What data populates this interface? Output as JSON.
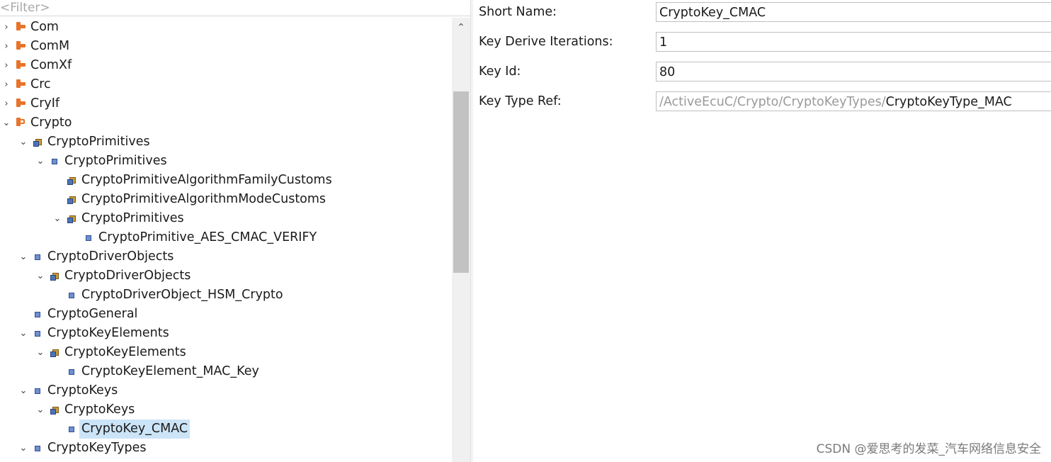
{
  "filter": {
    "placeholder": "<Filter>"
  },
  "tree": [
    {
      "label": "Com",
      "toggle": "›",
      "icon": "module-icon",
      "level": 0
    },
    {
      "label": "ComM",
      "toggle": "›",
      "icon": "module-icon",
      "level": 0
    },
    {
      "label": "ComXf",
      "toggle": "›",
      "icon": "module-icon",
      "level": 0
    },
    {
      "label": "Crc",
      "toggle": "›",
      "icon": "module-icon",
      "level": 0
    },
    {
      "label": "CryIf",
      "toggle": "›",
      "icon": "module-icon",
      "level": 0
    },
    {
      "label": "Crypto",
      "toggle": "⌄",
      "icon": "module-open-icon",
      "level": 0
    },
    {
      "label": "CryptoPrimitives",
      "toggle": "⌄",
      "icon": "container-icon",
      "level": 1
    },
    {
      "label": "CryptoPrimitives",
      "toggle": "⌄",
      "icon": "param-icon",
      "level": 2
    },
    {
      "label": "CryptoPrimitiveAlgorithmFamilyCustoms",
      "toggle": "",
      "icon": "container-icon",
      "level": 3
    },
    {
      "label": "CryptoPrimitiveAlgorithmModeCustoms",
      "toggle": "",
      "icon": "container-icon",
      "level": 3
    },
    {
      "label": "CryptoPrimitives",
      "toggle": "⌄",
      "icon": "container-icon",
      "level": 3
    },
    {
      "label": "CryptoPrimitive_AES_CMAC_VERIFY",
      "toggle": "",
      "icon": "param-icon",
      "level": 4
    },
    {
      "label": "CryptoDriverObjects",
      "toggle": "⌄",
      "icon": "param-icon",
      "level": 1
    },
    {
      "label": "CryptoDriverObjects",
      "toggle": "⌄",
      "icon": "container-icon",
      "level": 2
    },
    {
      "label": "CryptoDriverObject_HSM_Crypto",
      "toggle": "",
      "icon": "param-icon",
      "level": 3
    },
    {
      "label": "CryptoGeneral",
      "toggle": "",
      "icon": "param-icon",
      "level": 1
    },
    {
      "label": "CryptoKeyElements",
      "toggle": "⌄",
      "icon": "param-icon",
      "level": 1
    },
    {
      "label": "CryptoKeyElements",
      "toggle": "⌄",
      "icon": "container-icon",
      "level": 2
    },
    {
      "label": "CryptoKeyElement_MAC_Key",
      "toggle": "",
      "icon": "param-icon",
      "level": 3
    },
    {
      "label": "CryptoKeys",
      "toggle": "⌄",
      "icon": "param-icon",
      "level": 1
    },
    {
      "label": "CryptoKeys",
      "toggle": "⌄",
      "icon": "container-icon",
      "level": 2
    },
    {
      "label": "CryptoKey_CMAC",
      "toggle": "",
      "icon": "param-icon",
      "level": 3,
      "selected": true
    },
    {
      "label": "CryptoKeyTypes",
      "toggle": "⌄",
      "icon": "param-icon",
      "level": 1
    }
  ],
  "scroll_up_glyph": "⌃",
  "properties": {
    "short_name": {
      "label": "Short Name:",
      "value": "CryptoKey_CMAC"
    },
    "key_derive_iterations": {
      "label": "Key Derive Iterations:",
      "value": "1"
    },
    "key_id": {
      "label": "Key Id:",
      "value": "80"
    },
    "key_type_ref": {
      "label": "Key Type Ref:",
      "prefix": "/ActiveEcuC/Crypto/CryptoKeyTypes/",
      "value": "CryptoKeyType_MAC"
    }
  },
  "watermark": "CSDN @爱思考的发菜_汽车网络信息安全",
  "colors": {
    "selection": "#cce4f7",
    "module_icon": "#e8732a",
    "ref_prefix": "#9a9a9a"
  }
}
